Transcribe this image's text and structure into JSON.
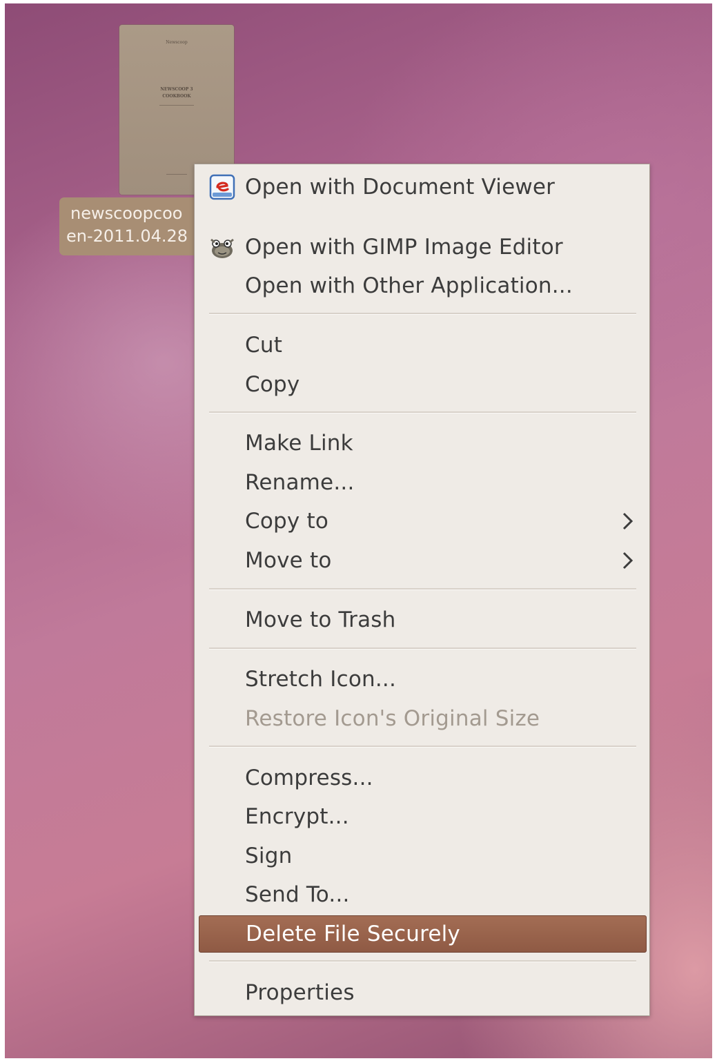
{
  "desktop": {
    "file": {
      "name_line1": "newscoopcoo",
      "name_line2": "en-2011.04.28",
      "thumbnail": {
        "brand": "Newscoop",
        "title_line1": "NEWSCOOP 3",
        "title_line2": "COOKBOOK"
      }
    }
  },
  "context_menu": {
    "groups": [
      [
        {
          "label": "Open with Document Viewer",
          "icon": "document-viewer-icon"
        },
        {
          "label": "Open with GIMP Image Editor",
          "icon": "gimp-icon"
        },
        {
          "label": "Open with Other Application..."
        }
      ],
      [
        {
          "label": "Cut"
        },
        {
          "label": "Copy"
        }
      ],
      [
        {
          "label": "Make Link"
        },
        {
          "label": "Rename..."
        },
        {
          "label": "Copy to",
          "submenu": true
        },
        {
          "label": "Move to",
          "submenu": true
        }
      ],
      [
        {
          "label": "Move to Trash"
        }
      ],
      [
        {
          "label": "Stretch Icon..."
        },
        {
          "label": "Restore Icon's Original Size",
          "disabled": true
        }
      ],
      [
        {
          "label": "Compress..."
        },
        {
          "label": "Encrypt..."
        },
        {
          "label": "Sign"
        },
        {
          "label": "Send To..."
        },
        {
          "label": "Delete File Securely",
          "highlighted": true
        }
      ],
      [
        {
          "label": "Properties"
        }
      ]
    ]
  },
  "colors": {
    "menu_background": "#efebe6",
    "highlight": "#9a644d",
    "disabled_text": "#a39a90",
    "file_label_background": "#a88e74"
  }
}
